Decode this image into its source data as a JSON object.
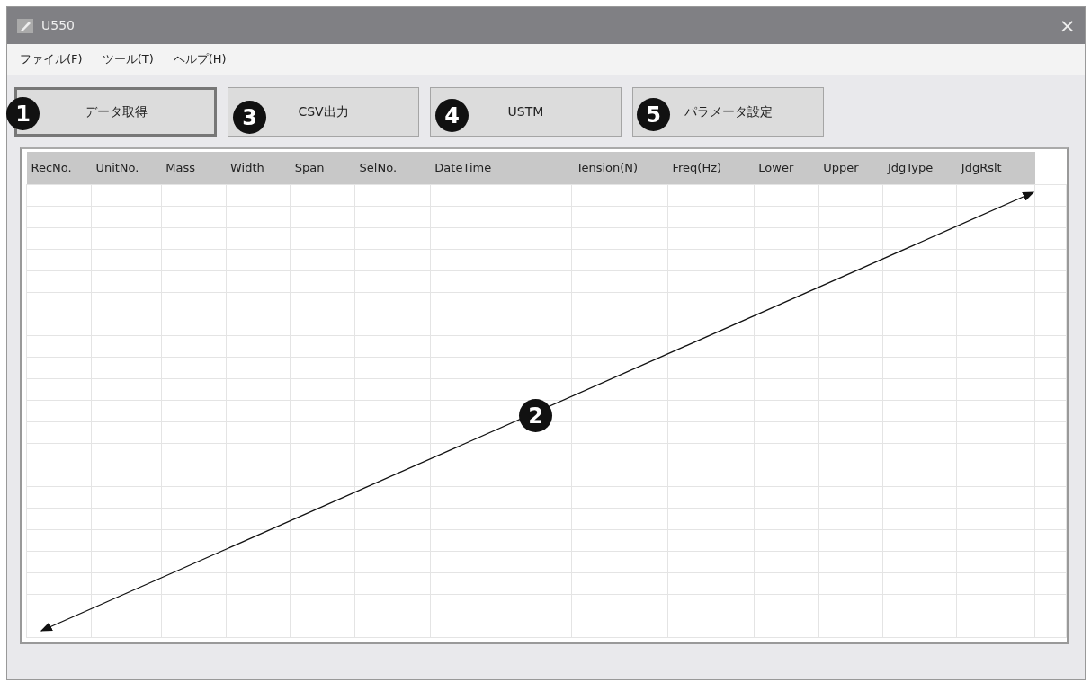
{
  "window": {
    "title": "U550",
    "close": "×"
  },
  "menu": [
    {
      "label": "ファイル(F)"
    },
    {
      "label": "ツール(T)"
    },
    {
      "label": "ヘルプ(H)"
    }
  ],
  "buttons": [
    {
      "label": "データ取得",
      "callout": "1",
      "focused": true
    },
    {
      "label": "CSV出力",
      "callout": "3",
      "focused": false
    },
    {
      "label": "USTM",
      "callout": "4",
      "focused": false
    },
    {
      "label": "パラメータ設定",
      "callout": "5",
      "focused": false
    }
  ],
  "table": {
    "columns": [
      "RecNo.",
      "UnitNo.",
      "Mass",
      "Width",
      "Span",
      "SelNo.",
      "DateTime",
      "Tension(N)",
      "Freq(Hz)",
      "Lower",
      "Upper",
      "JdgType",
      "JdgRslt"
    ],
    "annotation": {
      "callout": "2"
    }
  }
}
